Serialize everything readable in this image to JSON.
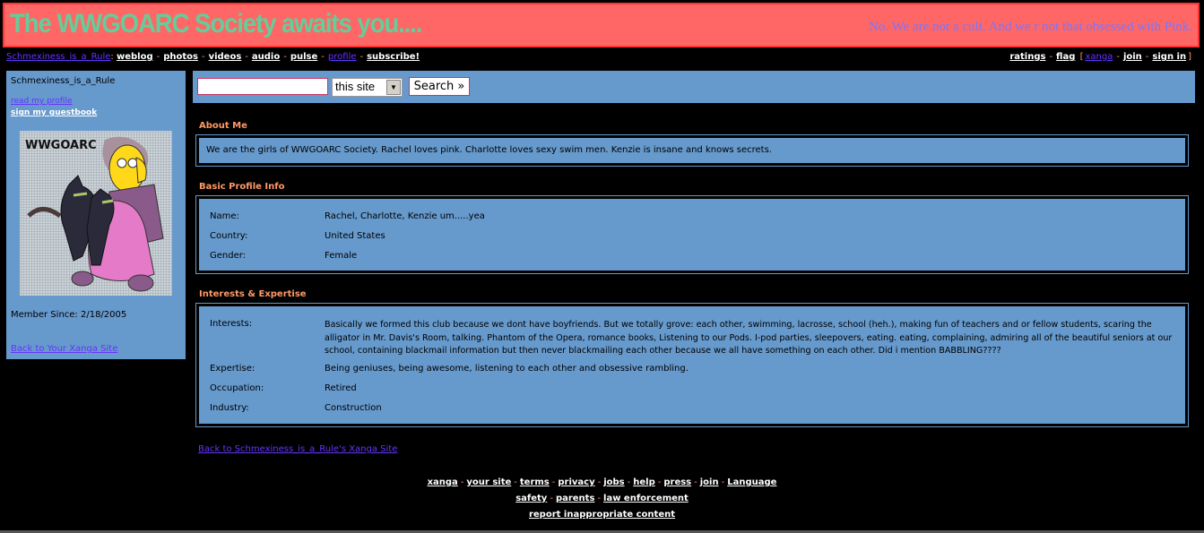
{
  "banner": {
    "title": "The WWGOARC Society awaits you....",
    "subtitle": "No. We are not a cult. And we r not that obsessed with Pink."
  },
  "topnav": {
    "site_name": "Schmexiness_is_a_Rule",
    "colon": ":",
    "items": [
      "weblog",
      "photos",
      "videos",
      "audio",
      "pulse",
      "profile",
      "subscribe!"
    ],
    "separator": "-"
  },
  "topright": {
    "ratings": "ratings",
    "flag": "flag",
    "open_bracket": "[",
    "xanga": "xanga",
    "join": "join",
    "sign_in": "sign in",
    "close_bracket": "]",
    "separator": "-"
  },
  "sidebar": {
    "username": "Schmexiness_is_a_Rule",
    "read_profile": "read my profile",
    "sign_guestbook": "sign my guestbook",
    "avatar_label": "WWGOARC",
    "member_since": "Member Since: 2/18/2005",
    "back_link": "Back to Your Xanga Site"
  },
  "search": {
    "input_value": "",
    "scope_selected": "this site",
    "button_label": "Search »"
  },
  "about": {
    "title": "About Me",
    "text": "We are the girls of WWGOARC Society. Rachel loves pink. Charlotte loves sexy swim men. Kenzie is insane and knows secrets."
  },
  "basic": {
    "title": "Basic Profile Info",
    "rows": [
      {
        "label": "Name:",
        "value": "Rachel, Charlotte, Kenzie um.....yea"
      },
      {
        "label": "Country:",
        "value": "United States"
      },
      {
        "label": "Gender:",
        "value": "Female"
      }
    ]
  },
  "interests": {
    "title": "Interests & Expertise",
    "rows": [
      {
        "label": "Interests:",
        "value": "Basically we formed this club because we dont have boyfriends. But we totally grove: each other, swimming, lacrosse, school (heh.), making fun of teachers and or fellow students, scaring the alligator in Mr. Davis's Room, talking. Phantom of the Opera, romance books, Listening to our Pods. I-pod parties, sleepovers, eating. eating, complaining, admiring all of the beautiful seniors at our school, containing blackmail information but then never blackmailing each other because we all have something on each other. Did i mention BABBLING????"
      },
      {
        "label": "Expertise:",
        "value": "Being geniuses, being awesome, listening to each other and obsessive rambling."
      },
      {
        "label": "Occupation:",
        "value": "Retired"
      },
      {
        "label": "Industry:",
        "value": "Construction"
      }
    ]
  },
  "back_main": "Back to Schmexiness_is_a_Rule's Xanga Site",
  "footer": {
    "line1": [
      "xanga",
      "your site",
      "terms",
      "privacy",
      "jobs",
      "help",
      "press",
      "join",
      "Language"
    ],
    "line2": [
      "safety",
      "parents",
      "law enforcement"
    ],
    "line3": [
      "report inappropriate content"
    ],
    "separator": "-"
  },
  "colors": {
    "background": "#000000",
    "banner_bg": "#ff6666",
    "banner_title": "#66cc99",
    "banner_subtitle": "#7777ff",
    "panel_bg": "#6699cc",
    "section_title": "#ff9966",
    "link_purple": "#6633ff",
    "link_white": "#ffffff"
  }
}
